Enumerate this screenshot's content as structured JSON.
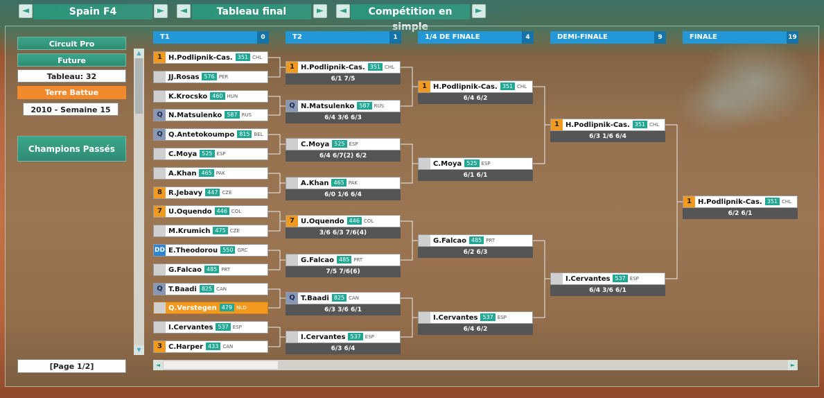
{
  "nav": {
    "tournament": "Spain F4",
    "view": "Tableau final",
    "competition": "Compétition en simple"
  },
  "sidebar": {
    "circuit": "Circuit Pro",
    "level": "Future",
    "draw": "Tableau: 32",
    "surface": "Terre Battue",
    "date": "2010 - Semaine 15",
    "champions": "Champions Passés",
    "page": "[Page 1/2]"
  },
  "rounds": [
    {
      "label": "T1",
      "count": "0"
    },
    {
      "label": "T2",
      "count": "1"
    },
    {
      "label": "1/4 DE FINALE",
      "count": "4"
    },
    {
      "label": "DEMI-FINALE",
      "count": "9"
    },
    {
      "label": "FINALE",
      "count": "19"
    }
  ],
  "r1": [
    {
      "seed": "1",
      "name": "H.Podlipnik-Cas.",
      "rank": "351",
      "country": "CHL"
    },
    {
      "seed": "",
      "name": "JJ.Rosas",
      "rank": "576",
      "country": "PER"
    },
    {
      "seed": "",
      "name": "K.Krocsko",
      "rank": "460",
      "country": "HUN"
    },
    {
      "seed": "Q",
      "name": "N.Matsulenko",
      "rank": "587",
      "country": "RUS"
    },
    {
      "seed": "Q",
      "name": "Q.Antetokoumpo",
      "rank": "815",
      "country": "BEL"
    },
    {
      "seed": "",
      "name": "C.Moya",
      "rank": "525",
      "country": "ESP"
    },
    {
      "seed": "",
      "name": "A.Khan",
      "rank": "465",
      "country": "PAK"
    },
    {
      "seed": "8",
      "name": "R.Jebavy",
      "rank": "447",
      "country": "CZE"
    },
    {
      "seed": "7",
      "name": "U.Oquendo",
      "rank": "446",
      "country": "COL"
    },
    {
      "seed": "",
      "name": "M.Krumich",
      "rank": "475",
      "country": "CZE"
    },
    {
      "seed": "DD",
      "name": "E.Theodorou",
      "rank": "550",
      "country": "GRC"
    },
    {
      "seed": "",
      "name": "G.Falcao",
      "rank": "485",
      "country": "PRT"
    },
    {
      "seed": "Q",
      "name": "T.Baadi",
      "rank": "825",
      "country": "CAN"
    },
    {
      "seed": "",
      "name": "Q.Verstegen",
      "rank": "479",
      "country": "NLD",
      "highlight": true
    },
    {
      "seed": "",
      "name": "I.Cervantes",
      "rank": "537",
      "country": "ESP"
    },
    {
      "seed": "3",
      "name": "C.Harper",
      "rank": "433",
      "country": "CAN"
    }
  ],
  "r2": [
    {
      "seed": "1",
      "name": "H.Podlipnik-Cas.",
      "rank": "351",
      "country": "CHL",
      "score": "6/1 7/5"
    },
    {
      "seed": "Q",
      "name": "N.Matsulenko",
      "rank": "587",
      "country": "RUS",
      "score": "6/4 3/6 6/3"
    },
    {
      "seed": "",
      "name": "C.Moya",
      "rank": "525",
      "country": "ESP",
      "score": "6/4 6/7(2) 6/2"
    },
    {
      "seed": "",
      "name": "A.Khan",
      "rank": "465",
      "country": "PAK",
      "score": "6/0 1/6 6/4"
    },
    {
      "seed": "7",
      "name": "U.Oquendo",
      "rank": "446",
      "country": "COL",
      "score": "3/6 6/3 7/6(4)"
    },
    {
      "seed": "",
      "name": "G.Falcao",
      "rank": "485",
      "country": "PRT",
      "score": "7/5 7/6(6)"
    },
    {
      "seed": "Q",
      "name": "T.Baadi",
      "rank": "825",
      "country": "CAN",
      "score": "6/3 3/6 6/1"
    },
    {
      "seed": "",
      "name": "I.Cervantes",
      "rank": "537",
      "country": "ESP",
      "score": "6/3 6/4"
    }
  ],
  "qf": [
    {
      "seed": "1",
      "name": "H.Podlipnik-Cas.",
      "rank": "351",
      "country": "CHL",
      "score": "6/4 6/2"
    },
    {
      "seed": "",
      "name": "C.Moya",
      "rank": "525",
      "country": "ESP",
      "score": "6/1 6/1"
    },
    {
      "seed": "",
      "name": "G.Falcao",
      "rank": "485",
      "country": "PRT",
      "score": "6/2 6/3"
    },
    {
      "seed": "",
      "name": "I.Cervantes",
      "rank": "537",
      "country": "ESP",
      "score": "6/4 6/2"
    }
  ],
  "sf": [
    {
      "seed": "1",
      "name": "H.Podlipnik-Cas.",
      "rank": "351",
      "country": "CHL",
      "score": "6/3 1/6 6/4"
    },
    {
      "seed": "",
      "name": "I.Cervantes",
      "rank": "537",
      "country": "ESP",
      "score": "6/4 3/6 6/1"
    }
  ],
  "final": [
    {
      "seed": "1",
      "name": "H.Podlipnik-Cas.",
      "rank": "351",
      "country": "CHL",
      "score": "6/2 6/1"
    }
  ],
  "icons": {
    "left": "◄",
    "right": "►",
    "up": "▲",
    "down": "▼"
  }
}
